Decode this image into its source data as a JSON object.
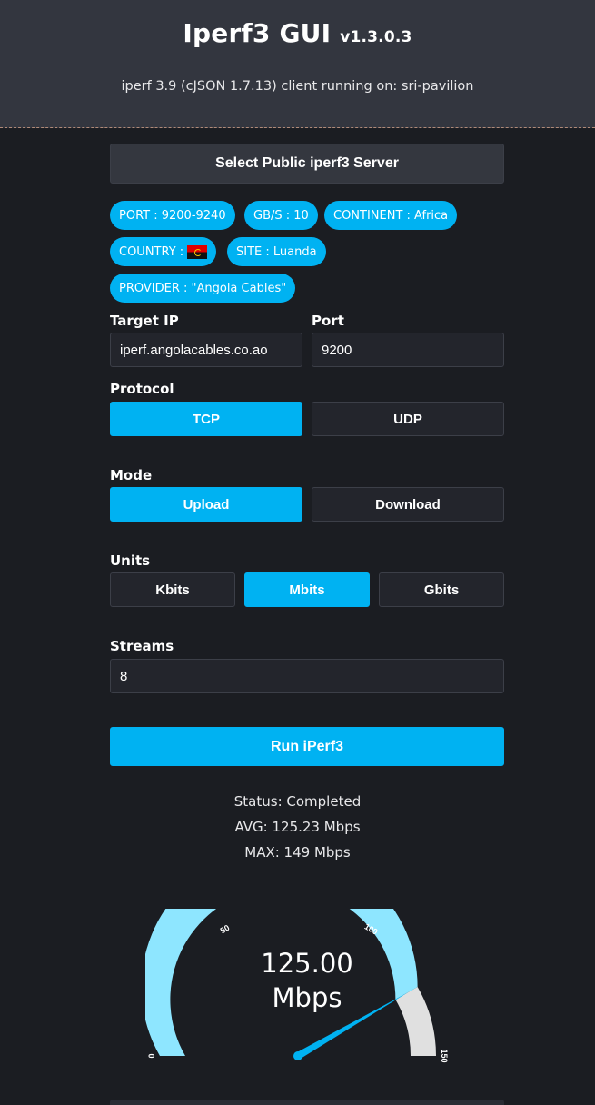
{
  "header": {
    "title": "Iperf3 GUI",
    "version": "v1.3.0.3",
    "subtitle": "iperf 3.9 (cJSON 1.7.13) client running on: sri-pavilion"
  },
  "server_button": "Select Public iperf3 Server",
  "tags": {
    "port": "PORT : 9200-9240",
    "gbs": "GB/S : 10",
    "continent": "CONTINENT : Africa",
    "country": "COUNTRY :",
    "country_flag_icon": "angola-flag-icon",
    "site": "SITE : Luanda",
    "provider": "PROVIDER : \"Angola Cables\""
  },
  "target_ip": {
    "label": "Target IP",
    "value": "iperf.angolacables.co.ao"
  },
  "port": {
    "label": "Port",
    "value": "9200"
  },
  "protocol": {
    "label": "Protocol",
    "options": [
      "TCP",
      "UDP"
    ],
    "selected": "TCP"
  },
  "mode": {
    "label": "Mode",
    "options": [
      "Upload",
      "Download"
    ],
    "selected": "Upload"
  },
  "units": {
    "label": "Units",
    "options": [
      "Kbits",
      "Mbits",
      "Gbits"
    ],
    "selected": "Mbits"
  },
  "streams": {
    "label": "Streams",
    "value": "8"
  },
  "run_button": "Run iPerf3",
  "status": {
    "status": "Status: Completed",
    "avg": "AVG: 125.23 Mbps",
    "max": "MAX: 149 Mbps"
  },
  "gauge": {
    "value": 125,
    "value_text": "125.00",
    "unit": "Mbps",
    "min": 0,
    "max": 150,
    "ticks": [
      "0",
      "50",
      "100",
      "150"
    ],
    "colors": {
      "fill": "#8ee6ff",
      "rest": "#e0e0e0",
      "needle": "#00b2f2"
    }
  },
  "colors": {
    "accent": "#00b2f2",
    "header_bg": "#33363f",
    "page_bg": "#1b1d22"
  }
}
